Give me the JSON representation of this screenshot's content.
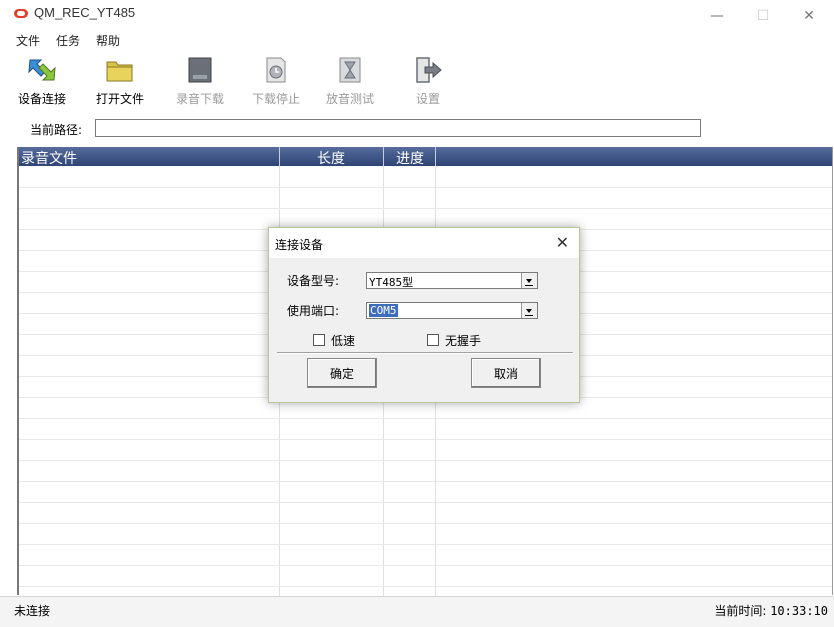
{
  "window": {
    "title": "QM_REC_YT485",
    "minimize_glyph": "—",
    "maximize_glyph": "☐",
    "close_glyph": "✕"
  },
  "menu": [
    "文件",
    "任务",
    "帮助"
  ],
  "toolbar": [
    {
      "label": "设备连接",
      "icon": "device-connect-icon",
      "enabled": true
    },
    {
      "label": "打开文件",
      "icon": "folder-icon",
      "enabled": true
    },
    {
      "label": "录音下载",
      "icon": "download-icon",
      "enabled": false
    },
    {
      "label": "下载停止",
      "icon": "stop-clock-icon",
      "enabled": false
    },
    {
      "label": "放音测试",
      "icon": "hourglass-icon",
      "enabled": false
    },
    {
      "label": "设置",
      "icon": "exit-arrow-icon",
      "enabled": true
    }
  ],
  "path": {
    "label": "当前路径:",
    "value": ""
  },
  "list": {
    "columns": [
      "录音文件",
      "长度",
      "进度"
    ],
    "header_color": "#2e4475"
  },
  "status": {
    "connection": "未连接",
    "time_label": "当前时间:",
    "time_value": "10:33:10"
  },
  "dialog": {
    "title": "连接设备",
    "close_glyph": "✕",
    "model_label": "设备型号:",
    "model_value": "YT485型",
    "port_label": "使用端口:",
    "port_value": "COM5",
    "low_speed_label": "低速",
    "no_handshake_label": "无握手",
    "ok_label": "确定",
    "cancel_label": "取消"
  }
}
